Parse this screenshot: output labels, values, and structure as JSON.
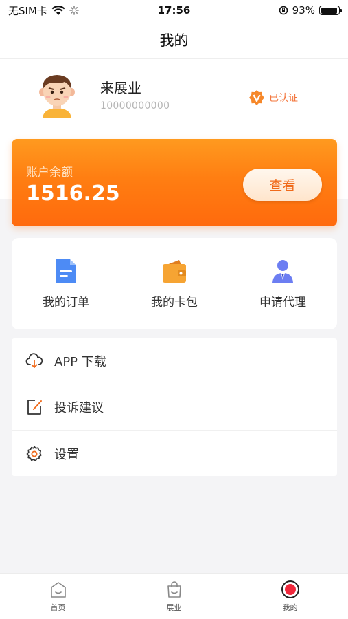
{
  "status_bar": {
    "carrier": "无SIM卡",
    "time": "17:56",
    "battery": "93%",
    "battery_level": 0.93
  },
  "nav": {
    "title": "我的"
  },
  "profile": {
    "name": "来展业",
    "id": "10000000000",
    "verified_label": "已认证"
  },
  "balance": {
    "label": "账户余额",
    "value": "1516.25",
    "button_label": "查看"
  },
  "quick_actions": [
    {
      "label": "我的订单",
      "icon": "document-icon",
      "color": "#4d8bf5"
    },
    {
      "label": "我的卡包",
      "icon": "wallet-icon",
      "color": "#f6a433"
    },
    {
      "label": "申请代理",
      "icon": "agent-icon",
      "color": "#6c7ef2"
    }
  ],
  "menu": [
    {
      "label": "APP 下载",
      "icon": "cloud-download-icon"
    },
    {
      "label": "投诉建议",
      "icon": "edit-icon"
    },
    {
      "label": "设置",
      "icon": "gear-icon"
    }
  ],
  "tabs": [
    {
      "label": "首页",
      "icon": "home-icon"
    },
    {
      "label": "展业",
      "icon": "bag-icon"
    },
    {
      "label": "我的",
      "icon": "profile-icon",
      "active": true
    }
  ],
  "colors": {
    "accent": "#ff7e12",
    "active_tab": "#f0283c"
  }
}
